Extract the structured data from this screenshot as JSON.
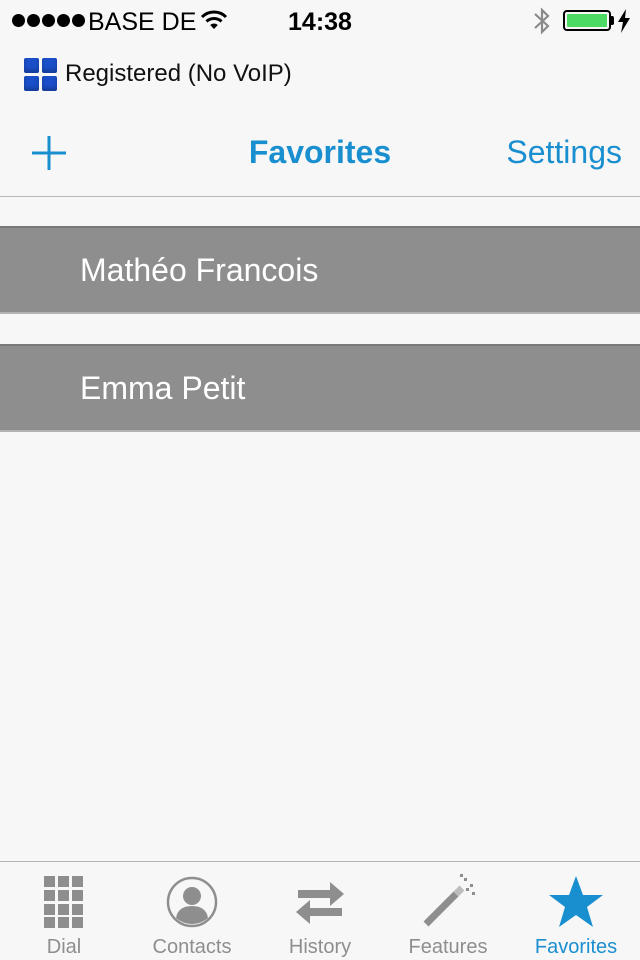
{
  "status_bar": {
    "carrier": "BASE DE",
    "time": "14:38",
    "battery_percent": 100,
    "icons": [
      "signal-dots",
      "wifi-icon",
      "bluetooth-icon",
      "battery-icon",
      "charging-bolt-icon"
    ]
  },
  "registration": {
    "status_text": "Registered (No VoIP)",
    "icon": "registration-grid-icon",
    "icon_color": "#1a4fc9"
  },
  "nav": {
    "add_icon": "plus-icon",
    "title": "Favorites",
    "settings_label": "Settings",
    "accent_color": "#1a8fd0"
  },
  "favorites": [
    {
      "name": "Mathéo Francois"
    },
    {
      "name": "Emma Petit"
    }
  ],
  "tab_bar": {
    "active_color": "#1a8fd0",
    "inactive_color": "#8e8e8e",
    "tabs": [
      {
        "label": "Dial",
        "icon": "keypad-icon",
        "active": false
      },
      {
        "label": "Contacts",
        "icon": "contact-silhouette-icon",
        "active": false
      },
      {
        "label": "History",
        "icon": "swap-arrows-icon",
        "active": false
      },
      {
        "label": "Features",
        "icon": "magic-wand-icon",
        "active": false
      },
      {
        "label": "Favorites",
        "icon": "star-icon",
        "active": true
      }
    ]
  }
}
